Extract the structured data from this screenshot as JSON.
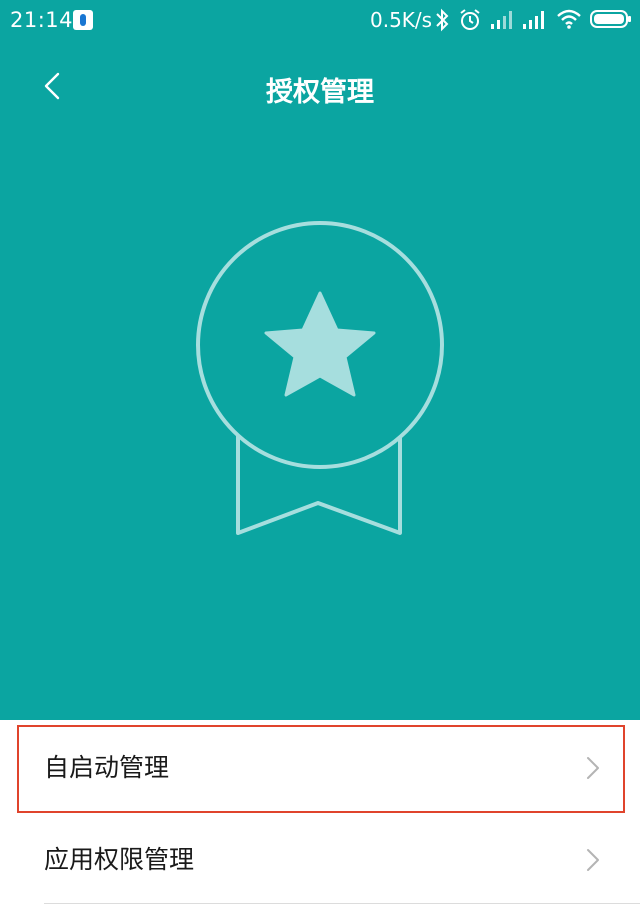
{
  "status_bar": {
    "time": "21:14",
    "network_speed": "0.5K/s",
    "icons": [
      "app-notification-icon",
      "bluetooth-icon",
      "alarm-icon",
      "signal-icon",
      "signal-icon",
      "wifi-icon",
      "battery-icon"
    ]
  },
  "header": {
    "title": "授权管理",
    "back_icon": "chevron-left-icon"
  },
  "hero": {
    "icon": "medal-star-icon"
  },
  "list": {
    "items": [
      {
        "label": "自启动管理",
        "icon": "chevron-right-icon",
        "highlighted": true
      },
      {
        "label": "应用权限管理",
        "icon": "chevron-right-icon",
        "highlighted": false
      }
    ]
  },
  "colors": {
    "primary": "#0ba5a1",
    "highlight_border": "#e0442c",
    "medal_fill": "#a6dede"
  }
}
